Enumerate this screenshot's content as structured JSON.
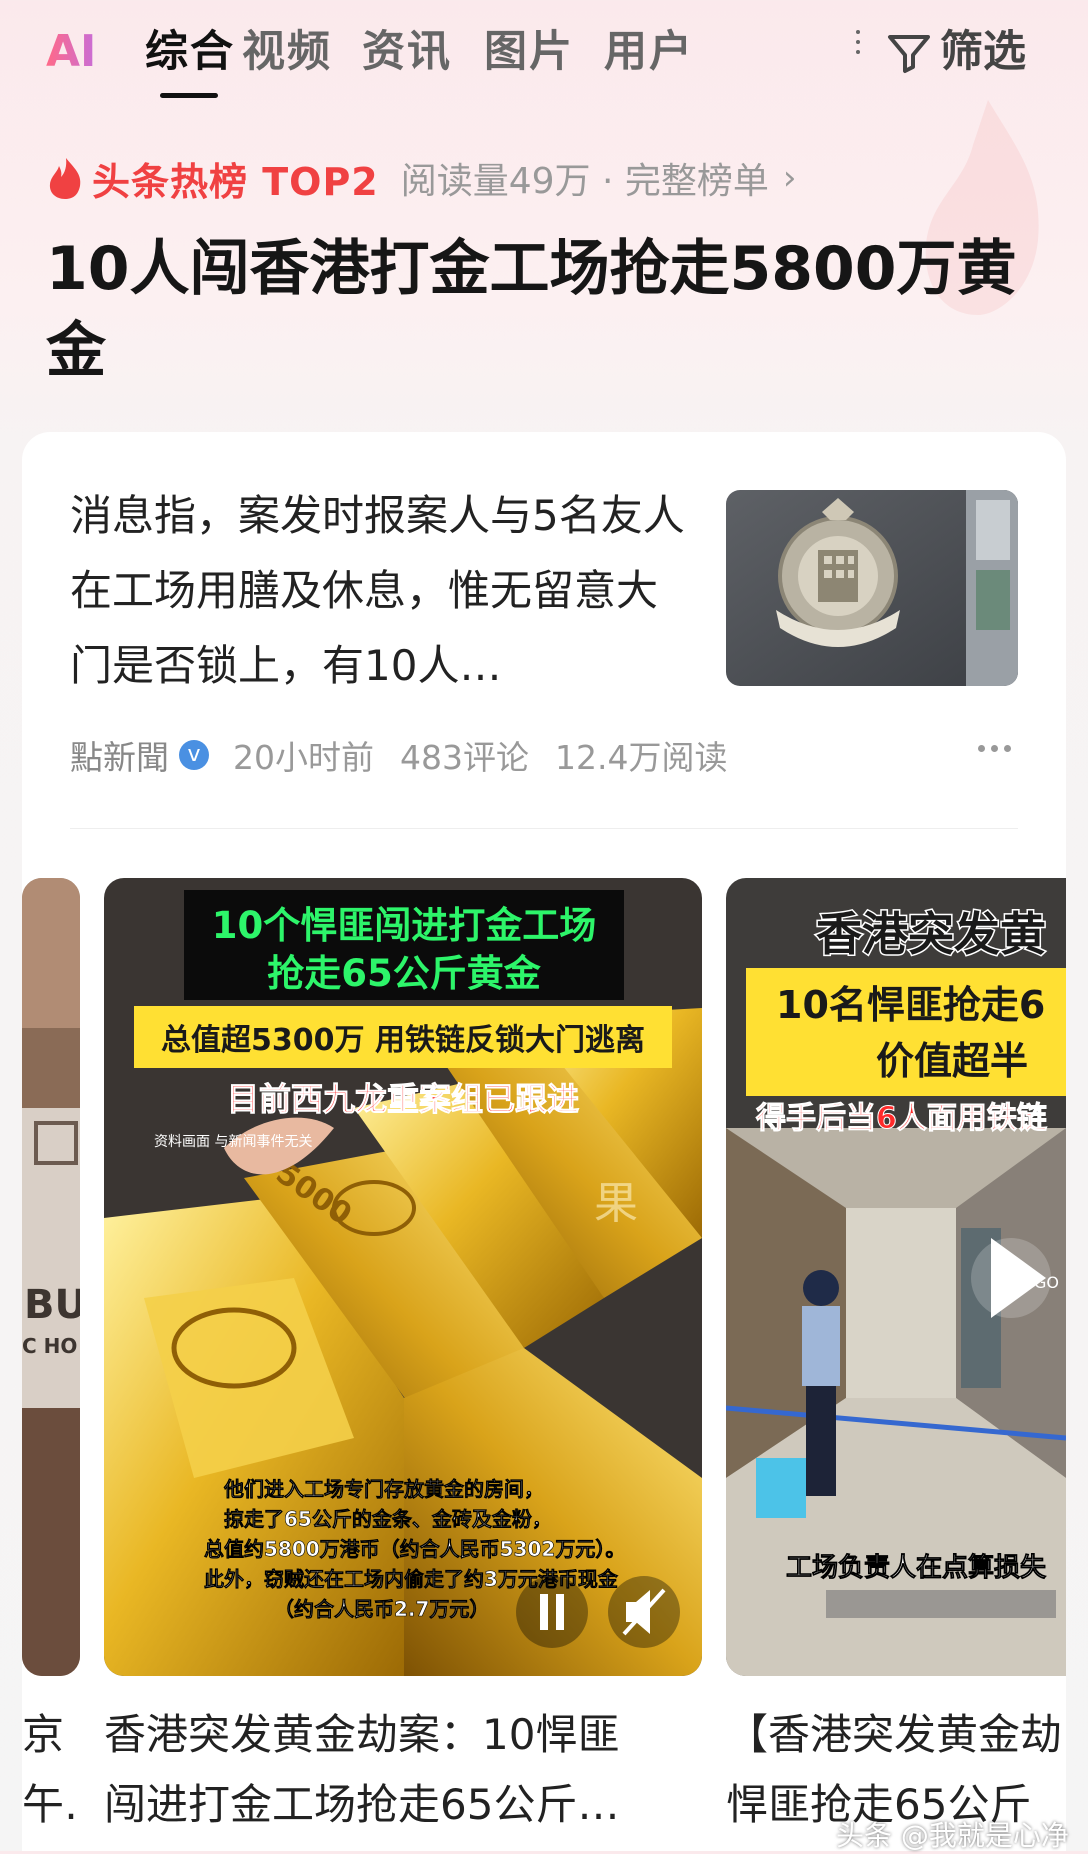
{
  "tabs": {
    "ai": "AI",
    "items": [
      "综合",
      "视频",
      "资讯",
      "图片",
      "用户"
    ],
    "active_index": 0,
    "filter_label": "筛选"
  },
  "hot": {
    "label": "头条热榜 TOP2",
    "meta": "阅读量49万 · 完整榜单",
    "chevron": "›"
  },
  "headline": "10人闯香港打金工场抢走5800万黄金",
  "article": {
    "summary": "消息指，案发时报案人与5名友人在工场用膳及休息，惟无留意大门是否锁上，有10人…",
    "source": "點新聞",
    "verified_mark": "v",
    "time": "20小时前",
    "comments": "483评论",
    "reads": "12.4万阅读",
    "thumb_sign": "香港 HONG KONG POLICE 警察"
  },
  "videos": [
    {
      "title_lines": [
        "京",
        "午…"
      ],
      "overlay": {
        "text_a": "BU",
        "text_b": "C HO"
      }
    },
    {
      "title_lines": [
        "香港突发黄金劫案：10悍匪",
        "闯进打金工场抢走65公斤…"
      ],
      "overlay": {
        "banner1": "10个悍匪闯进打金工场",
        "banner2": "抢走65公斤黄金",
        "yellow": "总值超5300万 用铁链反锁大门逃离",
        "red": "目前西九龙重案组已跟进",
        "small": "资料画面 与新闻事件无关",
        "caption": [
          "他们进入工场专门存放黄金的房间，",
          "掠走了65公斤的金条、金砖及金粉，",
          "总值约5800万港币（约合人民币5302万元）。",
          "此外，窃贼还在工场内偷走了约3万元港币现金",
          "（约合人民币2.7万元）"
        ],
        "brand": "果",
        "bar_stamp": "5000"
      }
    },
    {
      "title_lines": [
        "【香港突发黄金劫",
        "悍匪抢走65公斤"
      ],
      "overlay": {
        "top": "香港突发黄",
        "yellow1": "10名悍匪抢走6",
        "yellow2": "价值超半",
        "red": "得手后当6人面用铁链",
        "caption": "工场负责人在点算损失",
        "corner": "GO"
      }
    }
  ],
  "watermark": "头条 @我就是心净",
  "colors": {
    "accent_red": "#f04142",
    "verified_blue": "#4a90e2",
    "banner_green": "#2df56a",
    "banner_yellow": "#ffe033"
  }
}
